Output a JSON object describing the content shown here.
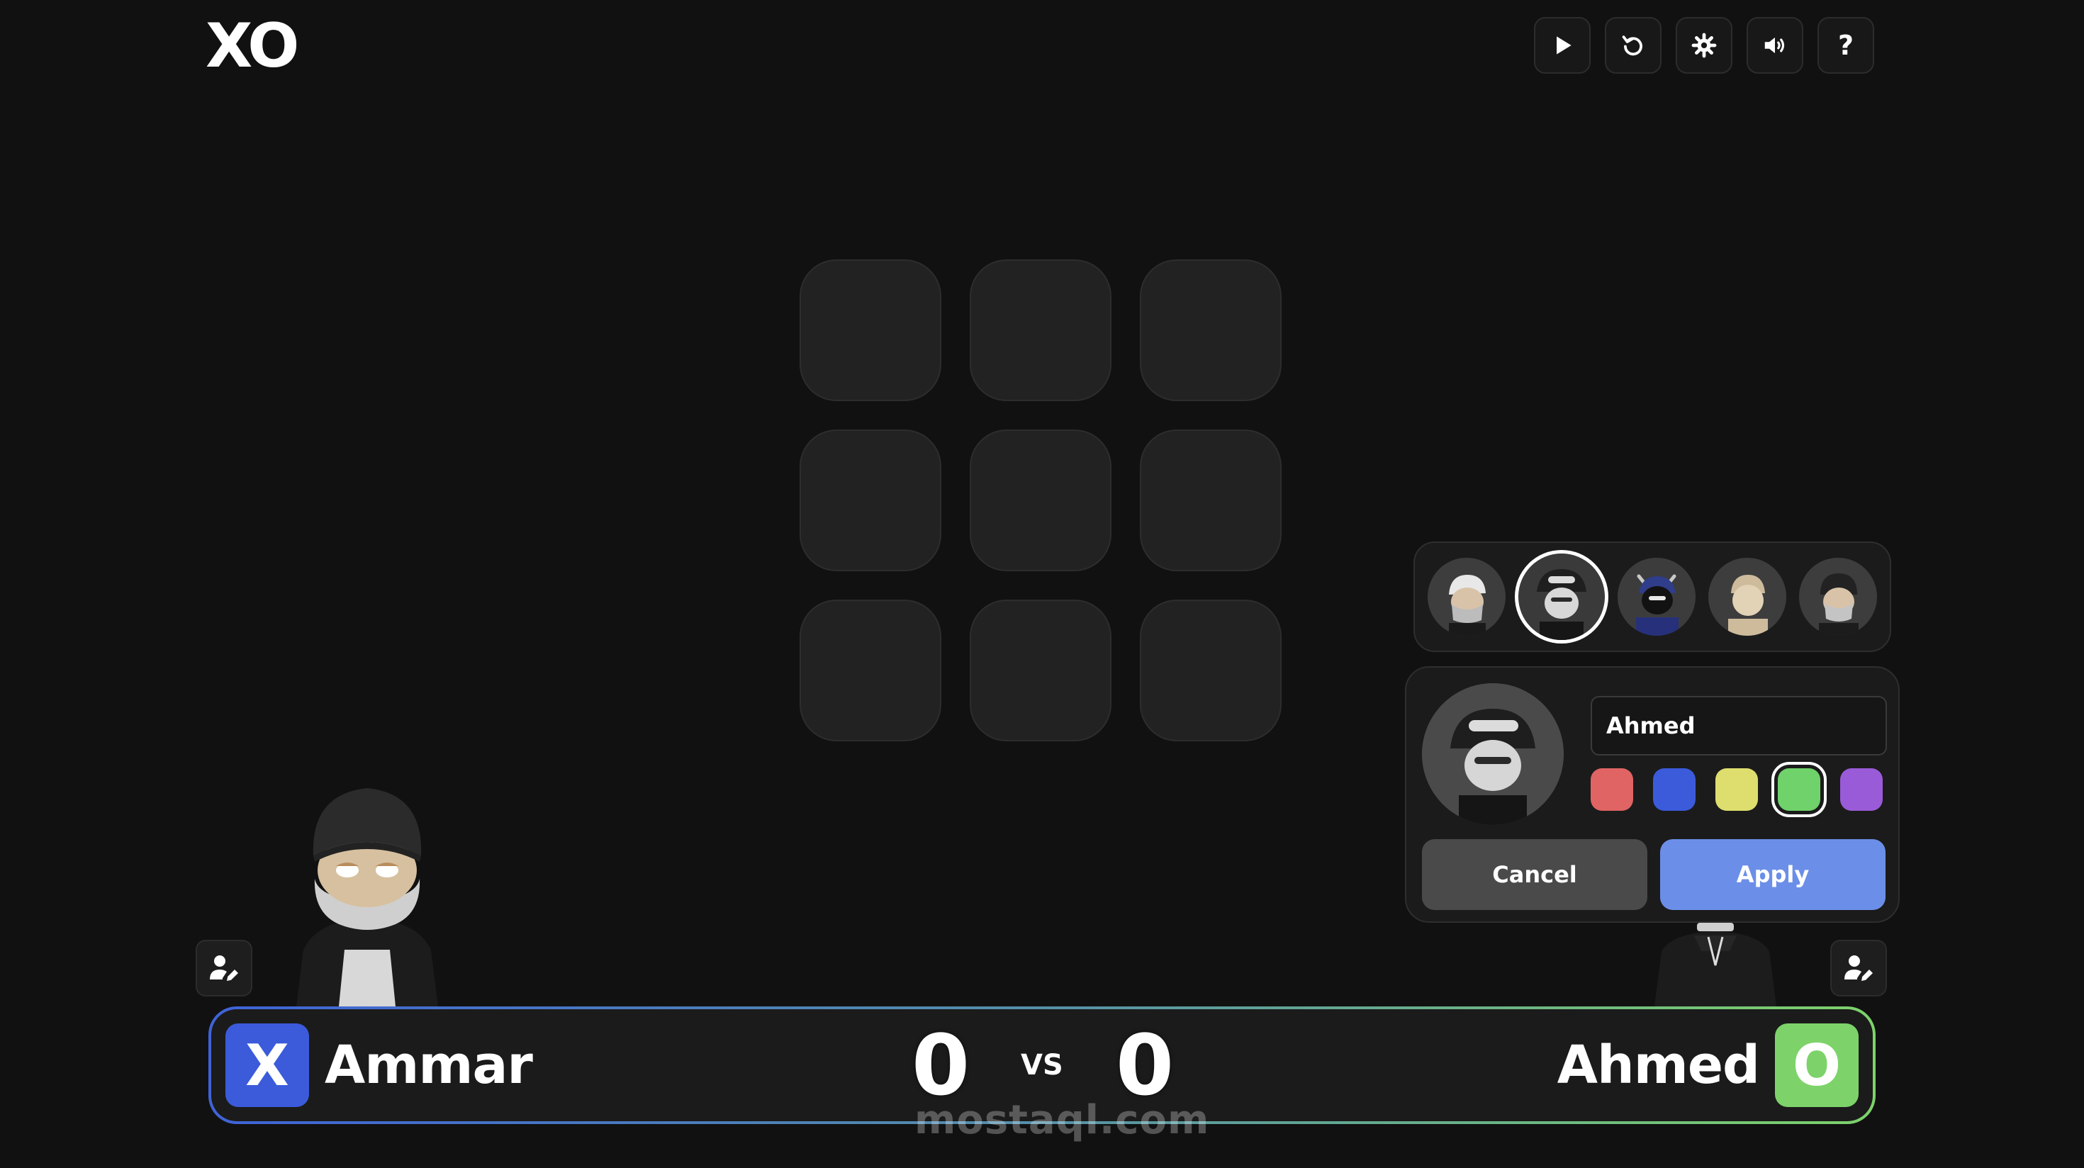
{
  "app": {
    "logo": "XO"
  },
  "toolbar": {
    "buttons": [
      {
        "icon": "play-icon"
      },
      {
        "icon": "restart-icon"
      },
      {
        "icon": "settings-gear-icon"
      },
      {
        "icon": "sound-icon"
      },
      {
        "icon": "help-icon",
        "label": "?"
      }
    ]
  },
  "board": {
    "cells": [
      "",
      "",
      "",
      "",
      "",
      "",
      "",
      "",
      ""
    ]
  },
  "avatar_picker": {
    "options": [
      "avatar-cap-mask",
      "avatar-bucket-hat",
      "avatar-blue-horned",
      "avatar-beige",
      "avatar-beanie-mask"
    ],
    "selected_index": 1
  },
  "profile_editor": {
    "name_value": "Ahmed",
    "colors": [
      "#e06464",
      "#3b5bdb",
      "#dede6e",
      "#6fd26a",
      "#9a5bd8"
    ],
    "selected_color_index": 3,
    "cancel_label": "Cancel",
    "apply_label": "Apply"
  },
  "scoreboard": {
    "player1": {
      "mark": "X",
      "name": "Ammar",
      "score": "0",
      "color": "#3b5bdb"
    },
    "vs_label": "VS",
    "player2": {
      "mark": "O",
      "name": "Ahmed",
      "score": "0",
      "color": "#7dd36a"
    }
  },
  "watermark": "mostaql.com"
}
